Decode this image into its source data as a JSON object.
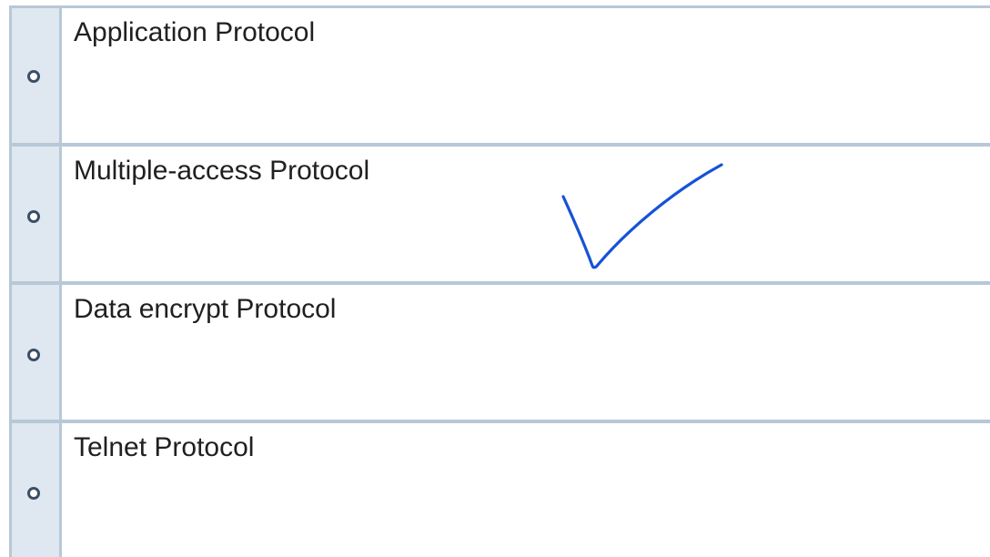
{
  "question": {
    "options": [
      {
        "label": "Application Protocol"
      },
      {
        "label": "Multiple-access Protocol"
      },
      {
        "label": "Data encrypt Protocol"
      },
      {
        "label": "Telnet Protocol"
      }
    ]
  },
  "annotation": {
    "type": "handwritten-checkmark",
    "marks_option": "Multiple-access Protocol",
    "color": "#1553d6"
  },
  "colors": {
    "border": "#b7c8d6",
    "radio_cell_bg": "#dfe7f0",
    "radio_ring": "#3b4f66",
    "text": "#202020"
  }
}
